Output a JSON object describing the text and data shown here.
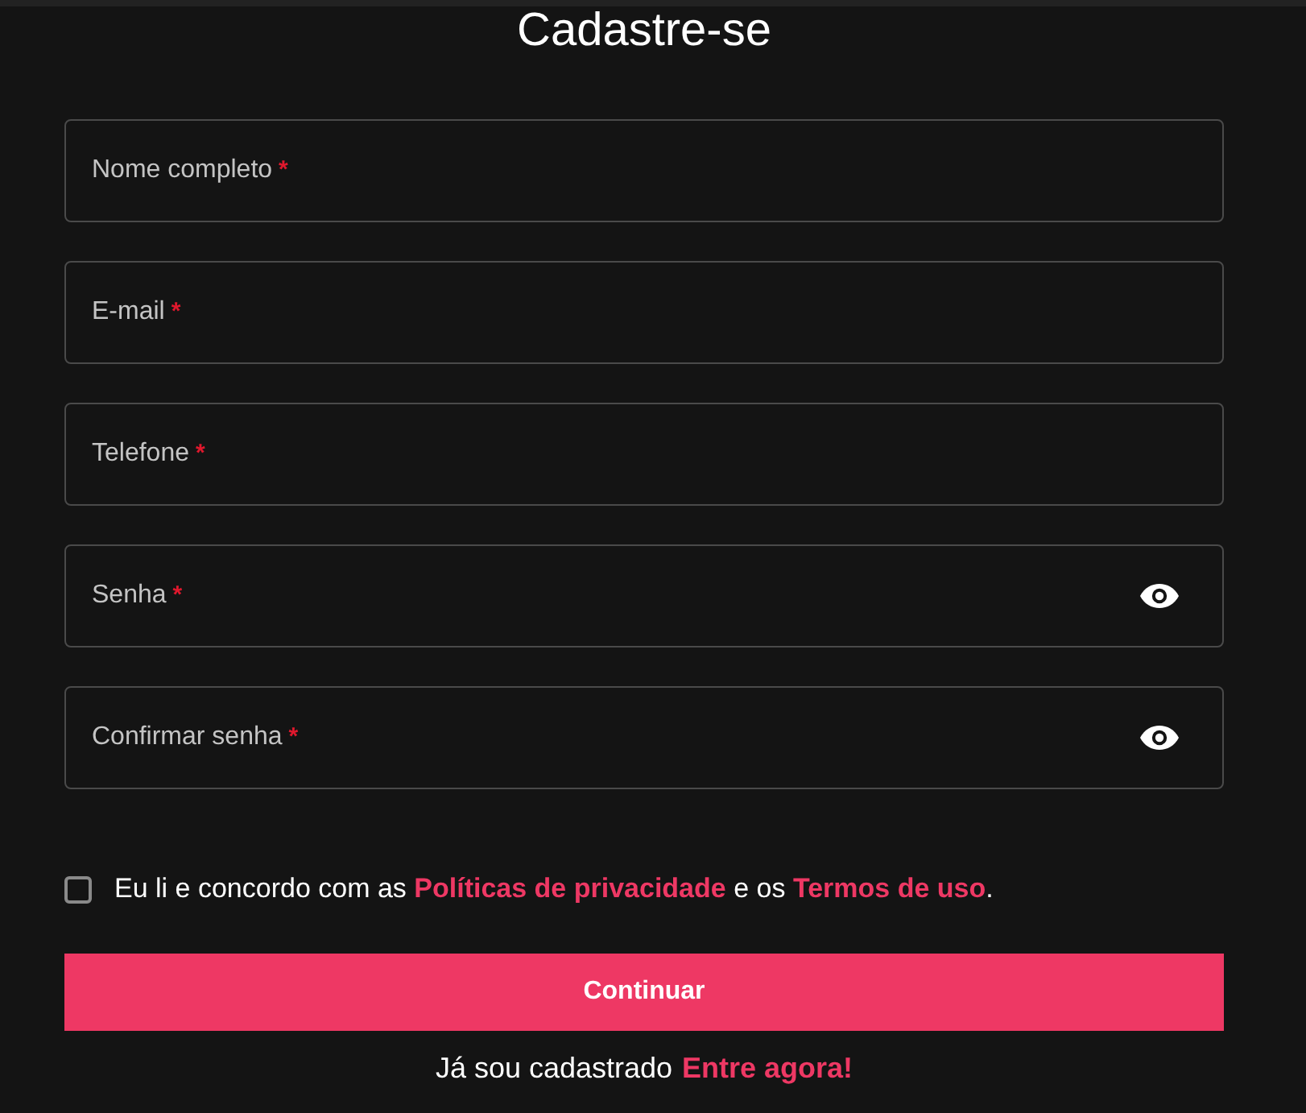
{
  "title": "Cadastre-se",
  "fields": [
    {
      "label": "Nome completo",
      "required_mark": "*",
      "kind": "text"
    },
    {
      "label": "E-mail",
      "required_mark": "*",
      "kind": "text"
    },
    {
      "label": "Telefone",
      "required_mark": "*",
      "kind": "text"
    },
    {
      "label": "Senha",
      "required_mark": "*",
      "kind": "password"
    },
    {
      "label": "Confirmar senha",
      "required_mark": "*",
      "kind": "password"
    }
  ],
  "consent": {
    "checked": false,
    "parts": [
      {
        "kind": "text",
        "text": "Eu li e concordo com as "
      },
      {
        "kind": "link",
        "text": "Políticas de privacidade"
      },
      {
        "kind": "text",
        "text": " e os "
      },
      {
        "kind": "link",
        "text": "Termos de uso"
      },
      {
        "kind": "text",
        "text": "."
      }
    ]
  },
  "button": "Continuar",
  "footer": {
    "text": "Já sou cadastrado",
    "link": "Entre agora!"
  }
}
